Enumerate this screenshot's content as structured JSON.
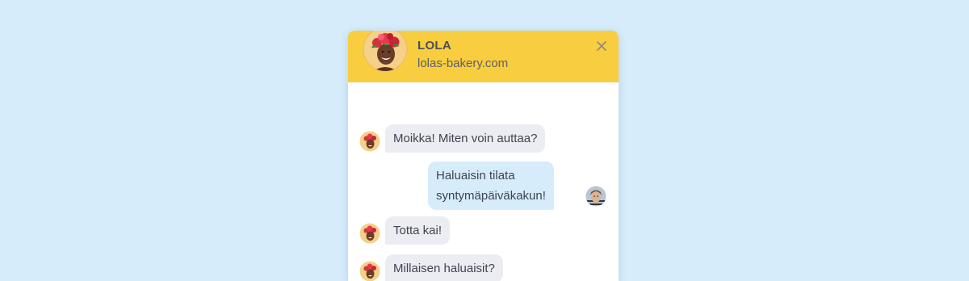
{
  "header": {
    "agent_name": "LOLA",
    "website": "lolas-bakery.com"
  },
  "messages": [
    {
      "sender": "agent",
      "lines": [
        "Moikka! Miten voin auttaa?"
      ]
    },
    {
      "sender": "visitor",
      "lines": [
        "Haluaisin tilata",
        "syntymäpäiväkakun!"
      ]
    },
    {
      "sender": "agent",
      "lines": [
        "Totta kai!"
      ]
    },
    {
      "sender": "agent",
      "lines": [
        "Millaisen haluaisit?"
      ]
    }
  ],
  "colors": {
    "page_background": "#d6ecfb",
    "header_background": "#f8cd40",
    "agent_bubble": "#ebedf3",
    "visitor_bubble": "#d6ecfb",
    "text": "#3f4450"
  },
  "icons": {
    "close": "close-icon",
    "agent_avatar": "agent-avatar",
    "visitor_avatar": "visitor-avatar"
  }
}
